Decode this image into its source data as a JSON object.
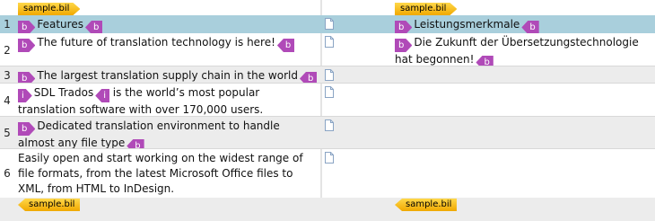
{
  "file_tags": {
    "source_start": "sample.bil",
    "target_start": "sample.bil",
    "source_end": "sample.bil",
    "target_end": "sample.bil"
  },
  "segments": [
    {
      "number": "1",
      "source": [
        {
          "type": "tag_open",
          "label": "b"
        },
        {
          "type": "text",
          "text": "Features"
        },
        {
          "type": "tag_close",
          "label": "b"
        }
      ],
      "target": [
        {
          "type": "tag_open",
          "label": "b"
        },
        {
          "type": "text",
          "text": "Leistungsmerkmale"
        },
        {
          "type": "tag_close",
          "label": "b"
        }
      ]
    },
    {
      "number": "2",
      "source": [
        {
          "type": "tag_open",
          "label": "b"
        },
        {
          "type": "text",
          "text": "The future of translation technology is here!"
        },
        {
          "type": "tag_close",
          "label": "b"
        }
      ],
      "target": [
        {
          "type": "tag_open",
          "label": "b"
        },
        {
          "type": "text",
          "text": "Die Zukunft der Übersetzungstechnologie hat begonnen!"
        },
        {
          "type": "tag_close",
          "label": "b"
        }
      ]
    },
    {
      "number": "3",
      "source": [
        {
          "type": "tag_open",
          "label": "b"
        },
        {
          "type": "text",
          "text": "The largest translation supply chain in the world"
        },
        {
          "type": "tag_close",
          "label": "b"
        }
      ],
      "target": []
    },
    {
      "number": "4",
      "source": [
        {
          "type": "tag_open",
          "label": "i"
        },
        {
          "type": "text",
          "text": "SDL Trados"
        },
        {
          "type": "tag_close",
          "label": "i"
        },
        {
          "type": "text",
          "text": " is the world’s most popular translation software with over 170,000 users."
        }
      ],
      "target": []
    },
    {
      "number": "5",
      "source": [
        {
          "type": "tag_open",
          "label": "b"
        },
        {
          "type": "text",
          "text": "Dedicated translation environment to handle almost any file type"
        },
        {
          "type": "tag_close",
          "label": "b"
        }
      ],
      "target": []
    },
    {
      "number": "6",
      "source": [
        {
          "type": "text",
          "text": "Easily open and start working on the widest range of file formats, from the latest Microsoft Office files to XML, from HTML to InDesign."
        }
      ],
      "target": []
    }
  ]
}
